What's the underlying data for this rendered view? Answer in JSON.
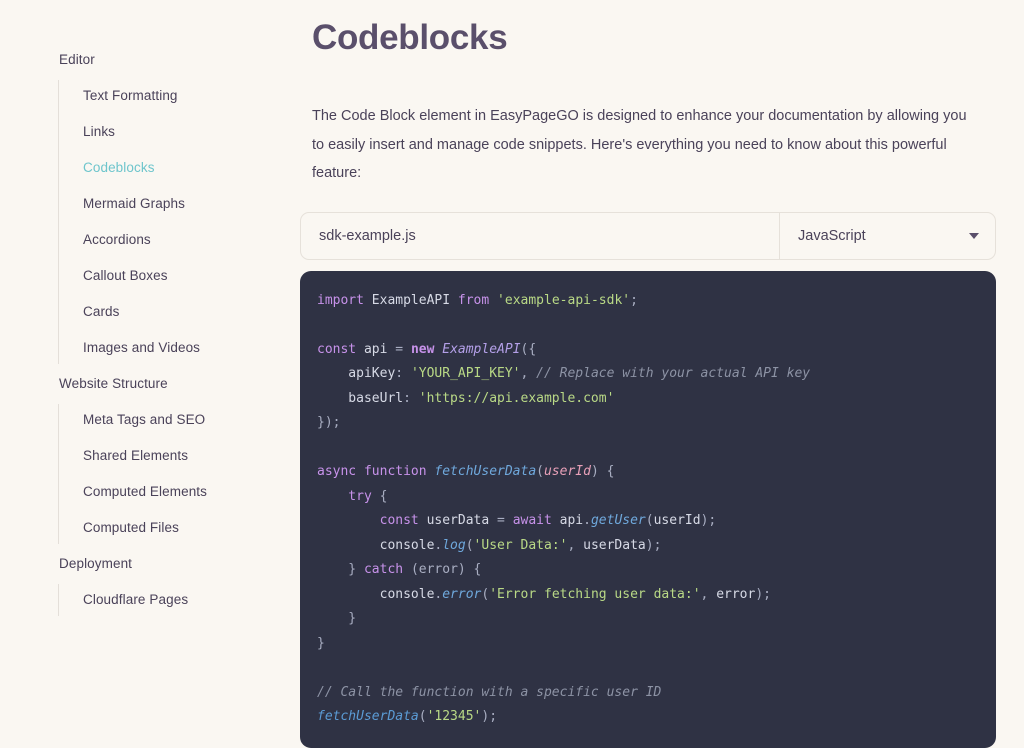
{
  "sidebar": {
    "groups": [
      {
        "label": "Editor",
        "items": [
          {
            "label": "Text Formatting",
            "active": false
          },
          {
            "label": "Links",
            "active": false
          },
          {
            "label": "Codeblocks",
            "active": true
          },
          {
            "label": "Mermaid Graphs",
            "active": false
          },
          {
            "label": "Accordions",
            "active": false
          },
          {
            "label": "Callout Boxes",
            "active": false
          },
          {
            "label": "Cards",
            "active": false
          },
          {
            "label": "Images and Videos",
            "active": false
          }
        ]
      },
      {
        "label": "Website Structure",
        "items": [
          {
            "label": "Meta Tags and SEO",
            "active": false
          },
          {
            "label": "Shared Elements",
            "active": false
          },
          {
            "label": "Computed Elements",
            "active": false
          },
          {
            "label": "Computed Files",
            "active": false
          }
        ]
      },
      {
        "label": "Deployment",
        "items": [
          {
            "label": "Cloudflare Pages",
            "active": false
          }
        ]
      }
    ]
  },
  "main": {
    "title": "Codeblocks",
    "intro": "The Code Block element in EasyPageGO is designed to enhance your documentation by allowing you to easily insert and manage code snippets. Here's everything you need to know about this powerful feature:"
  },
  "filebar": {
    "filename_value": "sdk-example.js",
    "filename_placeholder": "sdk-example.js",
    "language_value": "JavaScript",
    "chevron_icon": "chevron-down-icon"
  },
  "codeblock": {
    "language": "JavaScript",
    "lines": [
      [
        [
          "import ",
          "tok-kw"
        ],
        [
          "ExampleAPI",
          "tok-id"
        ],
        [
          " from ",
          "tok-kw"
        ],
        [
          "'example-api-sdk'",
          "tok-str"
        ],
        [
          ";",
          "tok-punc"
        ]
      ],
      [],
      [
        [
          "const ",
          "tok-kw"
        ],
        [
          "api ",
          "tok-id"
        ],
        [
          "= ",
          "tok-punc"
        ],
        [
          "new ",
          "tok-kw-b"
        ],
        [
          "ExampleAPI",
          "tok-cls"
        ],
        [
          "({",
          "tok-punc"
        ]
      ],
      [
        [
          "    apiKey",
          "tok-id"
        ],
        [
          ": ",
          "tok-punc"
        ],
        [
          "'YOUR_API_KEY'",
          "tok-str"
        ],
        [
          ", ",
          "tok-punc"
        ],
        [
          "// Replace with your actual API key",
          "tok-com"
        ]
      ],
      [
        [
          "    baseUrl",
          "tok-id"
        ],
        [
          ": ",
          "tok-punc"
        ],
        [
          "'https://api.example.com'",
          "tok-str"
        ]
      ],
      [
        [
          "});",
          "tok-punc"
        ]
      ],
      [],
      [
        [
          "async function ",
          "tok-kw"
        ],
        [
          "fetchUserData",
          "tok-fn"
        ],
        [
          "(",
          "tok-punc"
        ],
        [
          "userId",
          "tok-param"
        ],
        [
          ") {",
          "tok-punc"
        ]
      ],
      [
        [
          "    try ",
          "tok-kw"
        ],
        [
          "{",
          "tok-punc"
        ]
      ],
      [
        [
          "        const ",
          "tok-kw"
        ],
        [
          "userData ",
          "tok-id"
        ],
        [
          "= ",
          "tok-punc"
        ],
        [
          "await ",
          "tok-kw"
        ],
        [
          "api",
          "tok-id"
        ],
        [
          ".",
          "tok-punc"
        ],
        [
          "getUser",
          "tok-fn"
        ],
        [
          "(",
          "tok-punc"
        ],
        [
          "userId",
          "tok-id"
        ],
        [
          ");",
          "tok-punc"
        ]
      ],
      [
        [
          "        console",
          "tok-id"
        ],
        [
          ".",
          "tok-punc"
        ],
        [
          "log",
          "tok-fn"
        ],
        [
          "(",
          "tok-punc"
        ],
        [
          "'User Data:'",
          "tok-str"
        ],
        [
          ", ",
          "tok-punc"
        ],
        [
          "userData",
          "tok-id"
        ],
        [
          ");",
          "tok-punc"
        ]
      ],
      [
        [
          "    } ",
          "tok-punc"
        ],
        [
          "catch ",
          "tok-kw"
        ],
        [
          "(error) {",
          "tok-punc"
        ]
      ],
      [
        [
          "        console",
          "tok-id"
        ],
        [
          ".",
          "tok-punc"
        ],
        [
          "error",
          "tok-fn"
        ],
        [
          "(",
          "tok-punc"
        ],
        [
          "'Error fetching user data:'",
          "tok-str"
        ],
        [
          ", ",
          "tok-punc"
        ],
        [
          "error",
          "tok-id"
        ],
        [
          ");",
          "tok-punc"
        ]
      ],
      [
        [
          "    }",
          "tok-punc"
        ]
      ],
      [
        [
          "}",
          "tok-punc"
        ]
      ],
      [],
      [
        [
          "// Call the function with a specific user ID",
          "tok-com"
        ]
      ],
      [
        [
          "fetchUserData",
          "tok-fn2"
        ],
        [
          "(",
          "tok-punc"
        ],
        [
          "'12345'",
          "tok-str"
        ],
        [
          ");",
          "tok-punc"
        ]
      ]
    ]
  },
  "colors": {
    "page_background": "#faf7f2",
    "code_background": "#2f3244",
    "accent_active": "#6ec5cc",
    "title": "#5a4f6b",
    "body_text": "#4a4259"
  }
}
